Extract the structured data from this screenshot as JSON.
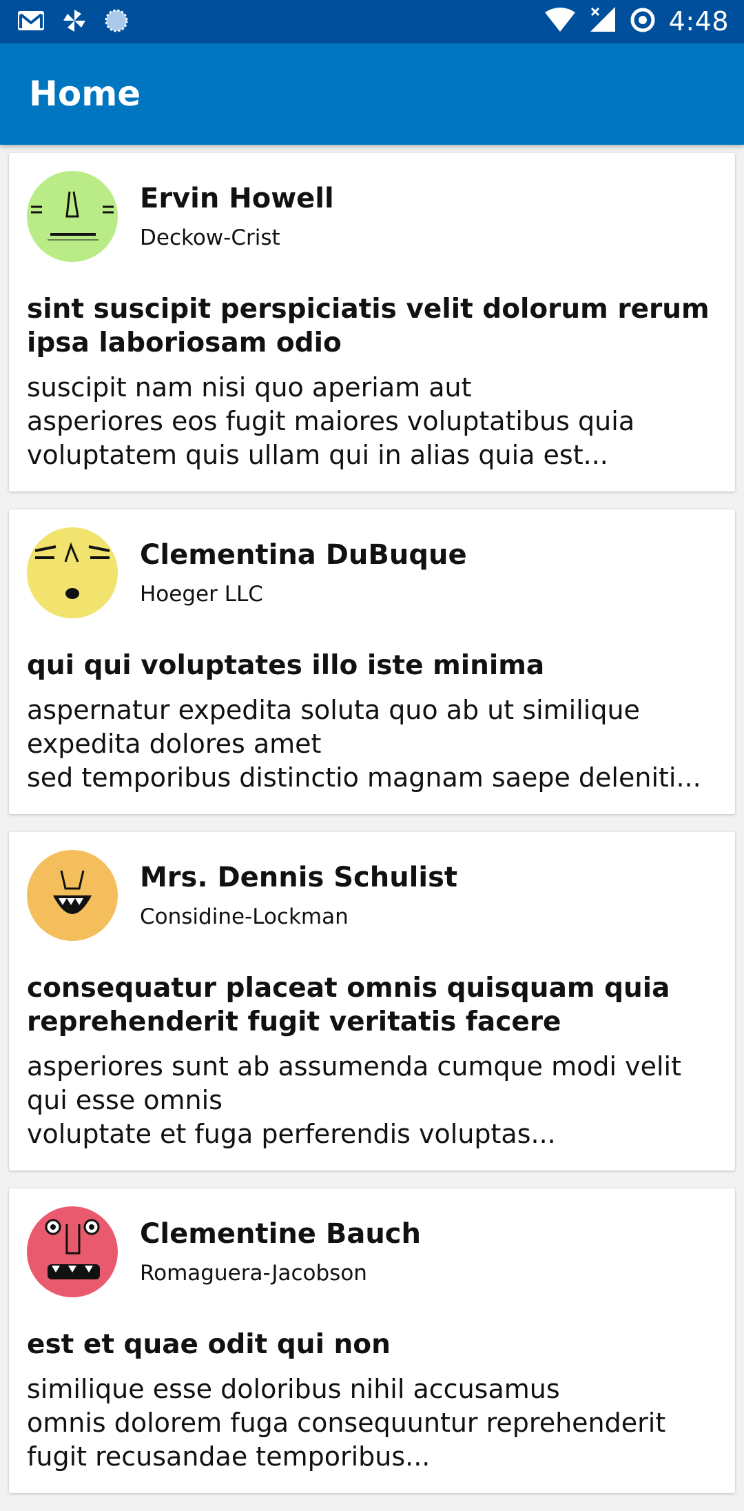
{
  "status_bar": {
    "time": "4:48",
    "left_icons": [
      "gmail-icon",
      "pinwheel-icon",
      "sync-icon"
    ],
    "right_icons": [
      "wifi-icon",
      "cell-signal-icon",
      "data-saver-icon"
    ]
  },
  "app_bar": {
    "title": "Home",
    "color": "#0076c0",
    "status_color": "#004f9c"
  },
  "posts": [
    {
      "author": "Ervin Howell",
      "company": "Deckow-Crist",
      "avatar_color": "#b9ec86",
      "title": "sint suscipit perspiciatis velit dolorum rerum ipsa laboriosam odio",
      "body": "suscipit nam nisi quo aperiam aut\nasperiores eos fugit maiores voluptatibus quia\nvoluptatem quis ullam qui in alias quia est..."
    },
    {
      "author": "Clementina DuBuque",
      "company": "Hoeger LLC",
      "avatar_color": "#f1e36d",
      "title": "qui qui voluptates illo iste minima",
      "body": "aspernatur expedita soluta quo ab ut similique\nexpedita dolores amet\nsed temporibus distinctio magnam saepe deleniti..."
    },
    {
      "author": "Mrs. Dennis Schulist",
      "company": "Considine-Lockman",
      "avatar_color": "#f5be5c",
      "title": "consequatur placeat omnis quisquam quia reprehenderit fugit veritatis facere",
      "body": "asperiores sunt ab assumenda cumque modi velit\nqui esse omnis\nvoluptate et fuga perferendis voluptas..."
    },
    {
      "author": "Clementine Bauch",
      "company": "Romaguera-Jacobson",
      "avatar_color": "#ea5a6e",
      "title": "est et quae odit qui non",
      "body": "similique esse doloribus nihil accusamus\nomnis dolorem fuga consequuntur reprehenderit\nfugit recusandae temporibus..."
    }
  ]
}
